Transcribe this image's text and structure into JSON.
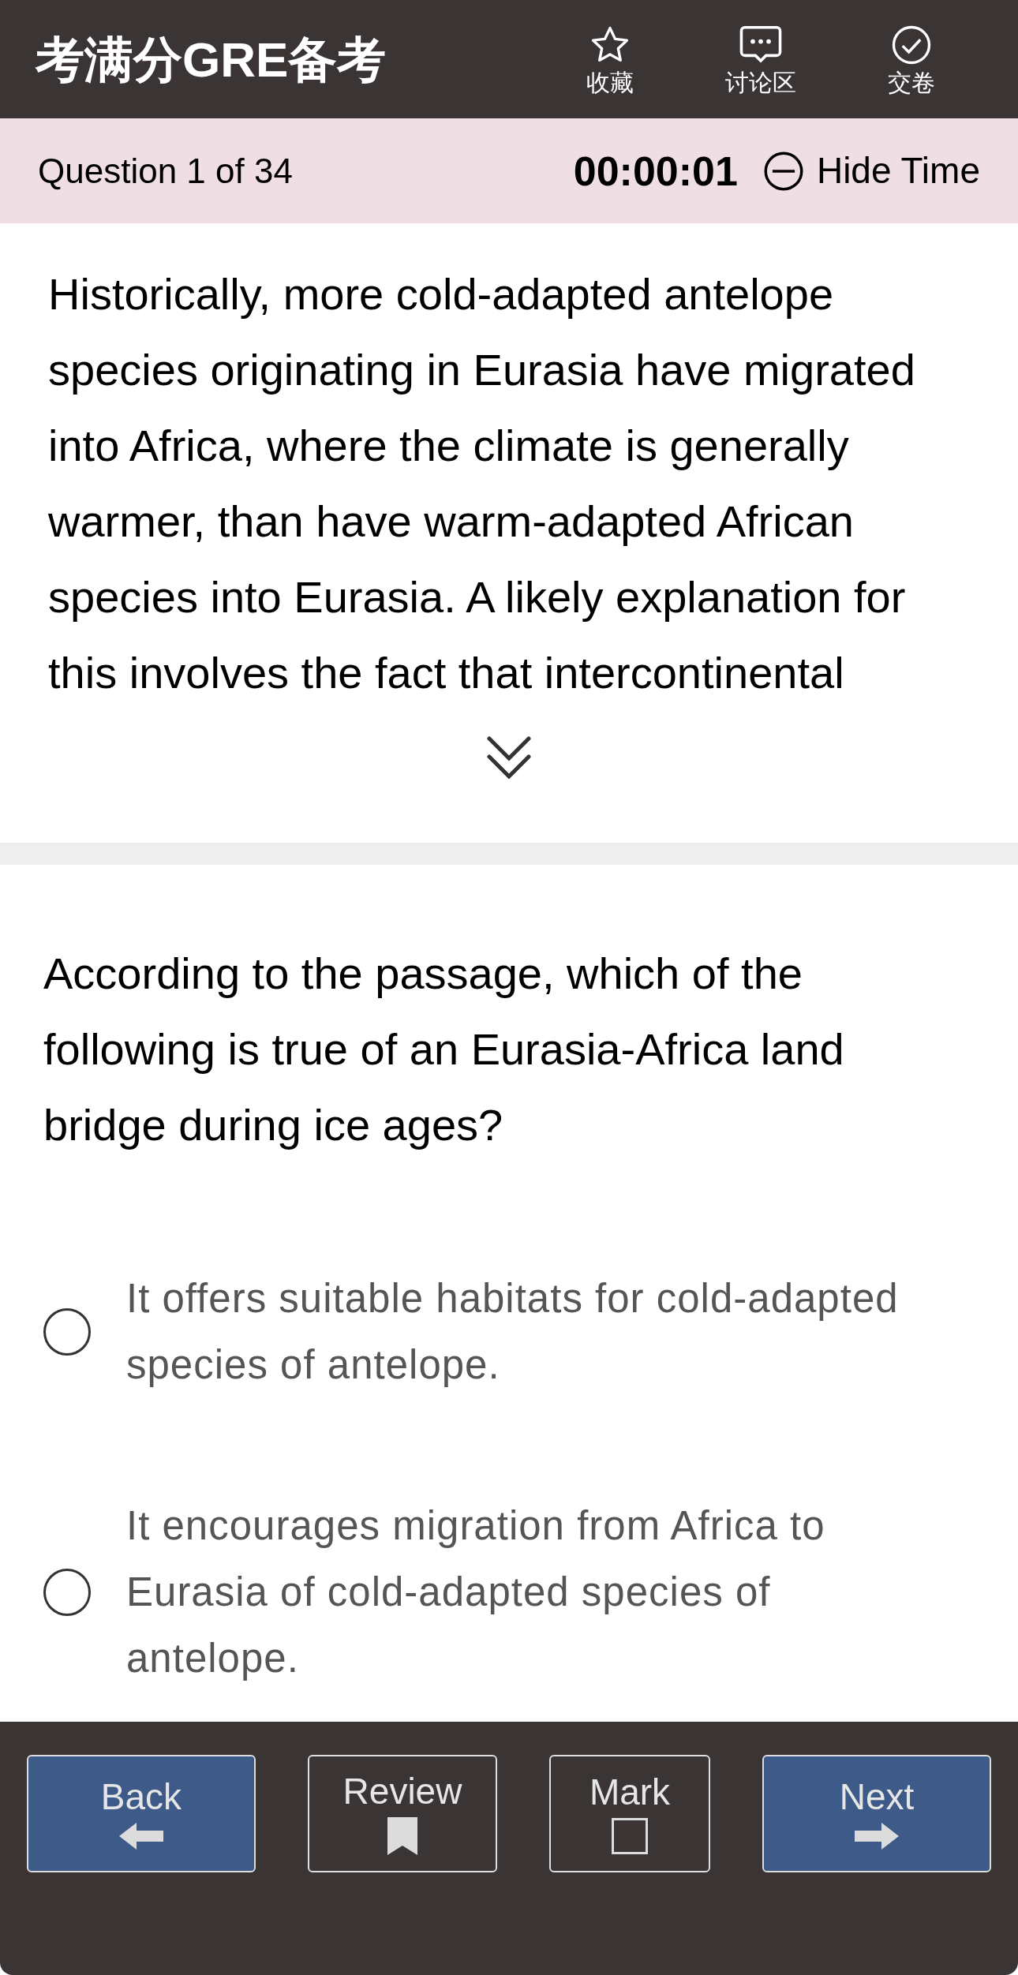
{
  "header": {
    "title": "考满分GRE备考",
    "actions": [
      {
        "kind": "star",
        "label": "收藏"
      },
      {
        "kind": "chat",
        "label": "讨论区"
      },
      {
        "kind": "check",
        "label": "交卷"
      }
    ]
  },
  "status_bar": {
    "question": "Question 1 of 34",
    "timer": "00:00:01",
    "hide_time": "Hide Time"
  },
  "passage": {
    "text": "Historically, more cold-adapted antelope species originating in Eurasia have migrated into Africa, where the climate is generally warmer, than have warm-adapted African species into Eurasia. A likely explanation for this involves the fact that intercontinental"
  },
  "question": "According to the passage, which of the following is true of an Eurasia-Africa land bridge during ice ages?",
  "options": [
    {
      "text": "It offers suitable habitats for cold-adapted species of antelope.",
      "selected": false
    },
    {
      "text": "It encourages migration from Africa to Eurasia of cold-adapted species of antelope.",
      "selected": false
    }
  ],
  "buttons": [
    {
      "kind": "back",
      "label": "Back"
    },
    {
      "kind": "review",
      "label": "Review"
    },
    {
      "kind": "mark",
      "label": "Mark",
      "checked": false
    },
    {
      "kind": "next",
      "label": "Next"
    }
  ]
}
